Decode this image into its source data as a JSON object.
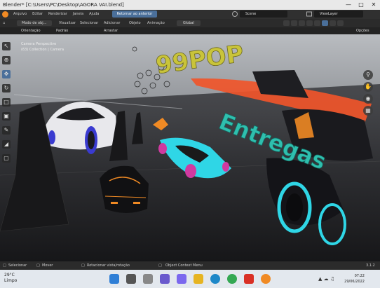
{
  "window": {
    "title": "Blender* [C:\\Users\\PC\\Desktop\\AGORA VAI.blend]",
    "controls": [
      "—",
      "□",
      "✕"
    ]
  },
  "menu": {
    "items": [
      "Arquivo",
      "Editar",
      "Renderizar",
      "Janela",
      "Ajuda"
    ],
    "workspace_tab": "Retornar ao anterior",
    "scene": "Scene",
    "view_layer": "ViewLayer"
  },
  "viewport_header": {
    "mode": "Modo de obj...",
    "menus": [
      "Visualizar",
      "Selecionar",
      "Adicionar",
      "Objeto",
      "Animação"
    ],
    "orientation": "Global",
    "sub_left": [
      "Orientação",
      "Padrão",
      "Arrastar"
    ],
    "options": "Opções"
  },
  "viewport": {
    "info_line1": "Camera Perspective",
    "info_line2": "(63) Collection | Camera",
    "text_99pop": "99POP",
    "text_entregas": "Entregas"
  },
  "status_bar": {
    "items": [
      "Selecionar",
      "Mover",
      "Rotacionar vista/rotação",
      "Object Context Menu"
    ],
    "version": "3.1.2"
  },
  "taskbar": {
    "temp": "29°C",
    "weather": "Limpo",
    "time": "07:22",
    "date": "29/06/2022"
  },
  "colors": {
    "accent": "#4a6f9a",
    "text3d_yellow": "#c9c43a",
    "text3d_teal": "#2fbfae",
    "car_cyan": "#2fd6e6"
  }
}
